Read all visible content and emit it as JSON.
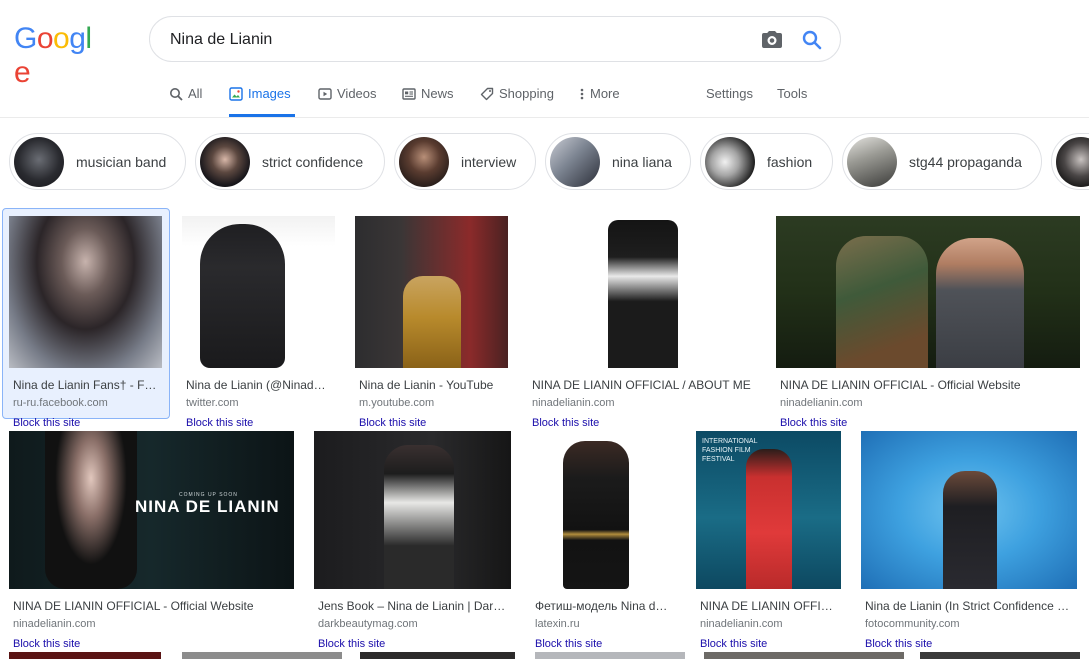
{
  "logo": {
    "letters": [
      "G",
      "o",
      "o",
      "g",
      "l",
      "e"
    ],
    "colors": [
      "#4285F4",
      "#EA4335",
      "#FBBC05",
      "#4285F4",
      "#34A853",
      "#EA4335"
    ]
  },
  "search": {
    "value": "Nina de Lianin"
  },
  "tabs": [
    {
      "label": "All",
      "icon": "search-icon"
    },
    {
      "label": "Images",
      "icon": "image-icon"
    },
    {
      "label": "Videos",
      "icon": "video-icon"
    },
    {
      "label": "News",
      "icon": "news-icon"
    },
    {
      "label": "Shopping",
      "icon": "tag-icon"
    },
    {
      "label": "More",
      "icon": "more-vert-icon"
    }
  ],
  "tools": {
    "settings": "Settings",
    "tools": "Tools"
  },
  "chips": [
    {
      "label": "musician band"
    },
    {
      "label": "strict confidence"
    },
    {
      "label": "interview"
    },
    {
      "label": "nina liana"
    },
    {
      "label": "fashion"
    },
    {
      "label": "stg44 propaganda"
    }
  ],
  "results": [
    {
      "title": "Nina de Lianin Fans† - F…",
      "source": "ru-ru.facebook.com",
      "block": "Block this site"
    },
    {
      "title": "Nina de Lianin (@Ninade…",
      "source": "twitter.com",
      "block": "Block this site"
    },
    {
      "title": "Nina de Lianin - YouTube",
      "source": "m.youtube.com",
      "block": "Block this site"
    },
    {
      "title": "NINA DE LIANIN OFFICIAL / ABOUT ME",
      "source": "ninadelianin.com",
      "block": "Block this site"
    },
    {
      "title": "NINA DE LIANIN OFFICIAL - Official Website",
      "source": "ninadelianin.com",
      "block": "Block this site"
    },
    {
      "title": "NINA DE LIANIN OFFICIAL - Official Website",
      "source": "ninadelianin.com",
      "block": "Block this site",
      "image_text": "NINA DE LIANIN",
      "image_small_text": "COMING UP SOON"
    },
    {
      "title": "Jens Book – Nina de Lianin | Dar…",
      "source": "darkbeautymag.com",
      "block": "Block this site"
    },
    {
      "title": "Фетиш-модель Nina d…",
      "source": "latexin.ru",
      "block": "Block this site"
    },
    {
      "title": "NINA DE LIANIN OFFIC…",
      "source": "ninadelianin.com",
      "block": "Block this site",
      "image_text": "INTERNATIONAL FASHION FILM FESTIVAL"
    },
    {
      "title": "Nina de Lianin (In Strict Confidence …",
      "source": "fotocommunity.com",
      "block": "Block this site"
    }
  ],
  "colors": {
    "accent": "#1a73e8",
    "link": "#1a0dab",
    "muted": "#70757a"
  }
}
